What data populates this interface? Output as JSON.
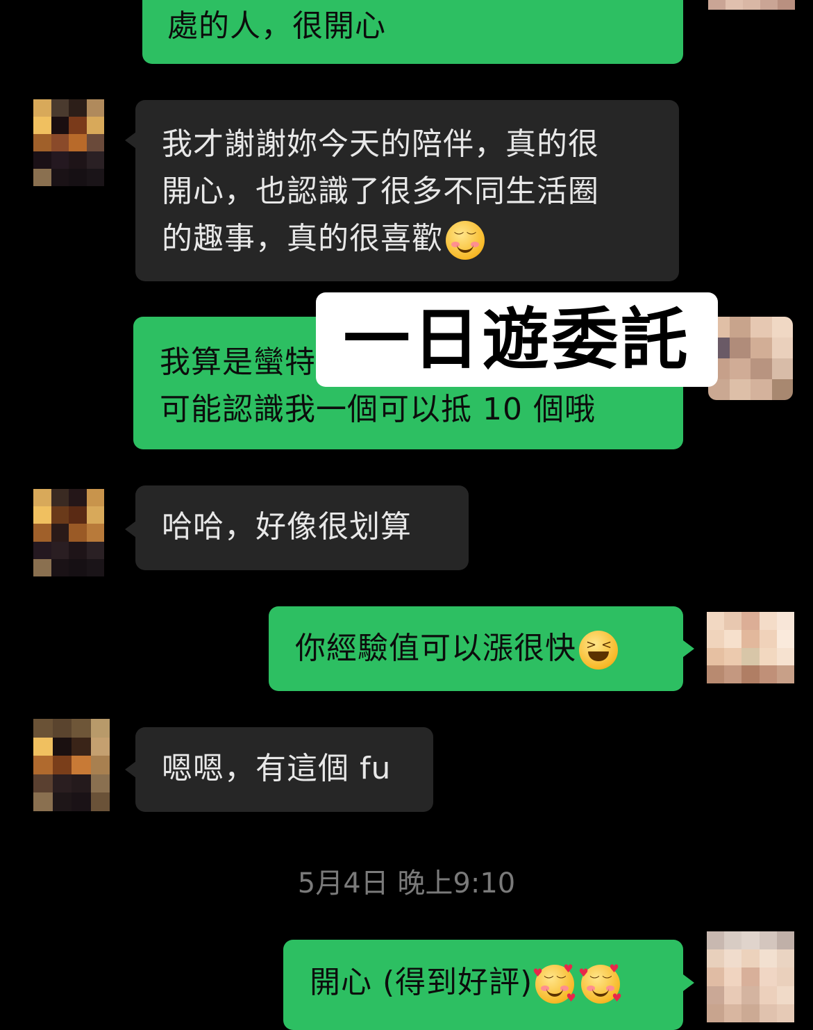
{
  "messages": [
    {
      "side": "right",
      "text": "處的人，很開心"
    },
    {
      "side": "left",
      "text_lines": [
        "我才謝謝妳今天的陪伴，真的很",
        "開心，也認識了很多不同生活圈",
        "的趣事，真的很喜歡"
      ],
      "emoji": "smiling-face-icon"
    },
    {
      "side": "right",
      "text_lines": [
        "我算是蠻特",
        "可能認識我一個可以抵 10 個哦"
      ]
    },
    {
      "side": "left",
      "text": "哈哈，好像很划算"
    },
    {
      "side": "right",
      "text": "你經驗值可以漲很快",
      "emoji": "grinning-squinting-face-icon"
    },
    {
      "side": "left",
      "text": "嗯嗯，有這個 fu"
    },
    {
      "side": "right",
      "text": "開心 (得到好評)",
      "emoji": "smiling-face-with-hearts-icon"
    }
  ],
  "timestamp": "5月4日 晚上9:10",
  "overlay_label": "一日遊委託",
  "colors": {
    "background": "#000000",
    "outgoing_bubble": "#2dbf62",
    "incoming_bubble": "#262626",
    "timestamp_text": "#7a7a7a"
  }
}
